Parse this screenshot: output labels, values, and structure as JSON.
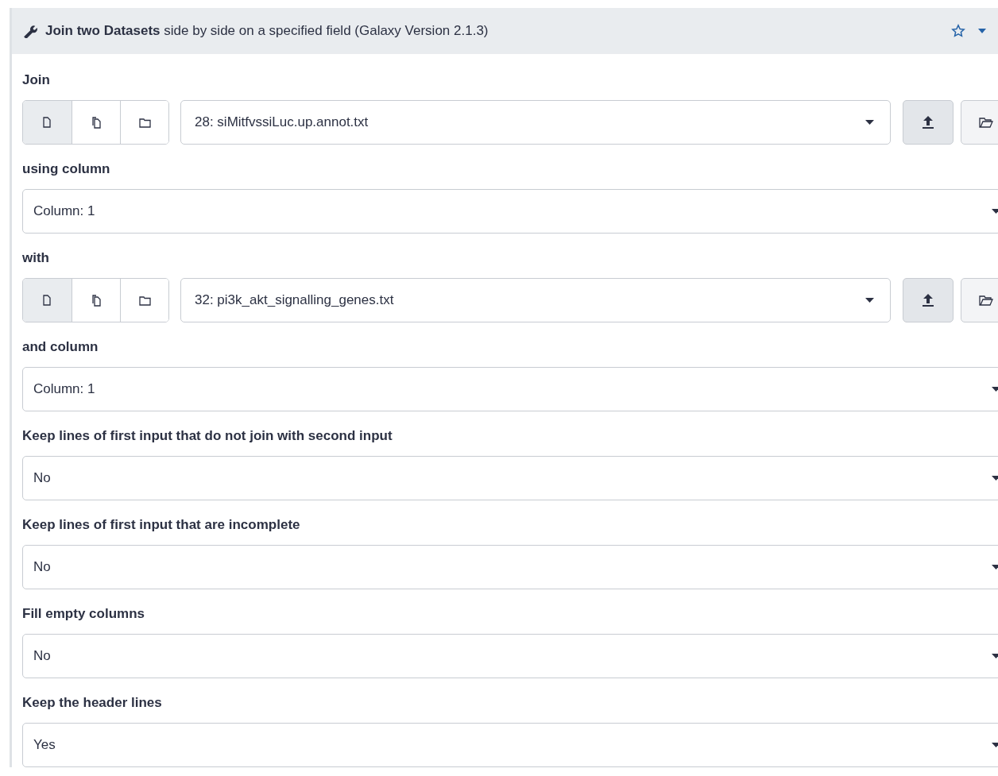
{
  "header": {
    "title": "**Join two Datasets** side by side on a specified field (Galaxy Version 2.1.3)"
  },
  "fields": [
    {
      "kind": "dataset",
      "label": "Join",
      "modes": [
        {
          "selected": true
        },
        {
          "selected": false
        },
        {
          "selected": false
        }
      ],
      "value": "28: siMitfvssiLuc.up.annot.txt"
    },
    {
      "kind": "select",
      "label": "using column",
      "value": "Column: 1"
    },
    {
      "kind": "dataset",
      "label": "with",
      "modes": [
        {
          "selected": true
        },
        {
          "selected": false
        },
        {
          "selected": false
        }
      ],
      "value": "32: pi3k_akt_signalling_genes.txt"
    },
    {
      "kind": "select",
      "label": "and column",
      "value": "Column: 1"
    },
    {
      "kind": "select",
      "label": "Keep lines of first input that do not join with second input",
      "value": "No"
    },
    {
      "kind": "select",
      "label": "Keep lines of first input that are incomplete",
      "value": "No"
    },
    {
      "kind": "select",
      "label": "Fill empty columns",
      "value": "No"
    },
    {
      "kind": "select",
      "label": "Keep the header lines",
      "value": "Yes"
    }
  ]
}
